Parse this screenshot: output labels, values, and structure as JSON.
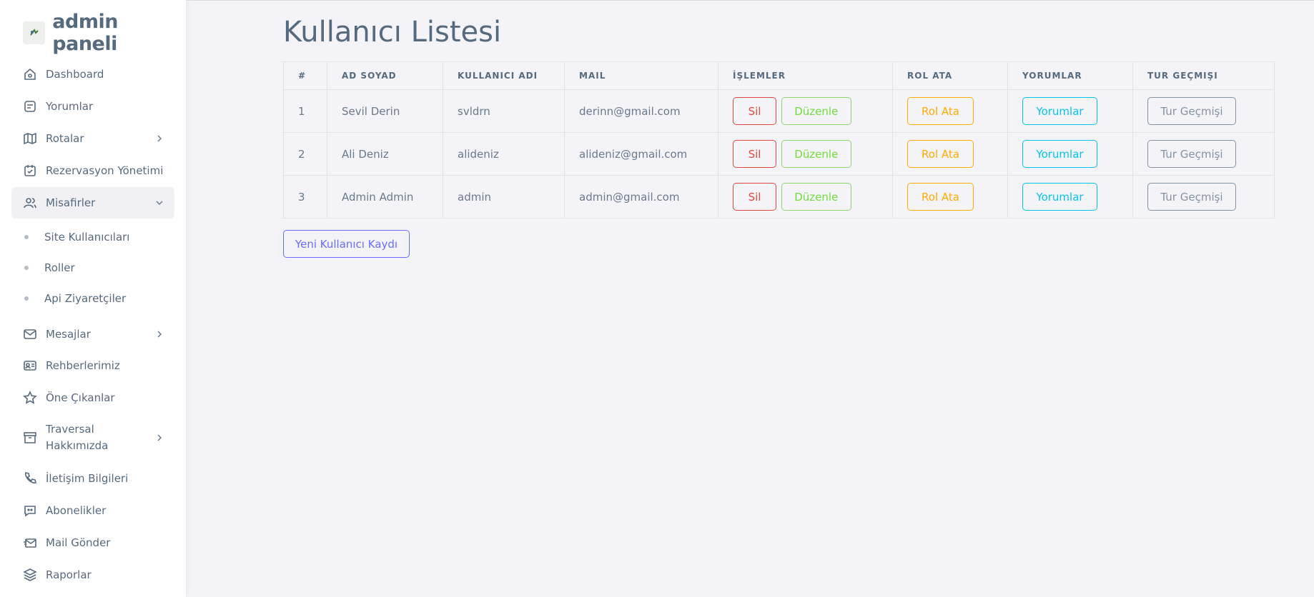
{
  "brand": {
    "name": "admin paneli"
  },
  "sidebar": {
    "items": [
      {
        "label": "Dashboard",
        "icon": "home-icon"
      },
      {
        "label": "Yorumlar",
        "icon": "comment-icon"
      },
      {
        "label": "Rotalar",
        "icon": "map-icon"
      },
      {
        "label": "Rezervasyon Yönetimi",
        "icon": "calendar-check-icon"
      },
      {
        "label": "Misafirler",
        "icon": "users-icon"
      },
      {
        "label": "Mesajlar",
        "icon": "mail-icon"
      },
      {
        "label": "Rehberlerimiz",
        "icon": "id-card-icon"
      },
      {
        "label": "Öne Çıkanlar",
        "icon": "star-icon"
      },
      {
        "label": "Traversal",
        "label2": "Hakkımızda",
        "icon": "archive-icon"
      },
      {
        "label": "İletişim Bilgileri",
        "icon": "phone-icon"
      },
      {
        "label": "Abonelikler",
        "icon": "chat-icon"
      },
      {
        "label": "Mail Gönder",
        "icon": "send-mail-icon"
      },
      {
        "label": "Raporlar",
        "icon": "layers-icon"
      }
    ],
    "subitems": [
      {
        "label": "Site Kullanıcıları"
      },
      {
        "label": "Roller"
      },
      {
        "label": "Api Ziyaretçiler"
      }
    ]
  },
  "page": {
    "title": "Kullanıcı Listesi"
  },
  "table": {
    "headers": [
      "#",
      "AD SOYAD",
      "KULLANICI ADI",
      "MAIL",
      "İŞLEMLER",
      "ROL ATA",
      "YORUMLAR",
      "TUR GEÇMIŞI"
    ],
    "rows": [
      {
        "id": "1",
        "name": "Sevil Derin",
        "username": "svldrn",
        "mail": "derinn@gmail.com"
      },
      {
        "id": "2",
        "name": "Ali Deniz",
        "username": "alideniz",
        "mail": "alideniz@gmail.com"
      },
      {
        "id": "3",
        "name": "Admin Admin",
        "username": "admin",
        "mail": "admin@gmail.com"
      }
    ],
    "buttons": {
      "delete": "Sil",
      "edit": "Düzenle",
      "assign_role": "Rol Ata",
      "comments": "Yorumlar",
      "tour_history": "Tur Geçmişi"
    }
  },
  "actions": {
    "new_user": "Yeni Kullanıcı Kaydı"
  },
  "colors": {
    "danger": "#e0493f",
    "success": "#71dd37",
    "warning": "#ffab00",
    "info": "#03c3ec",
    "secondary": "#8592a3",
    "primary": "#696cff"
  }
}
